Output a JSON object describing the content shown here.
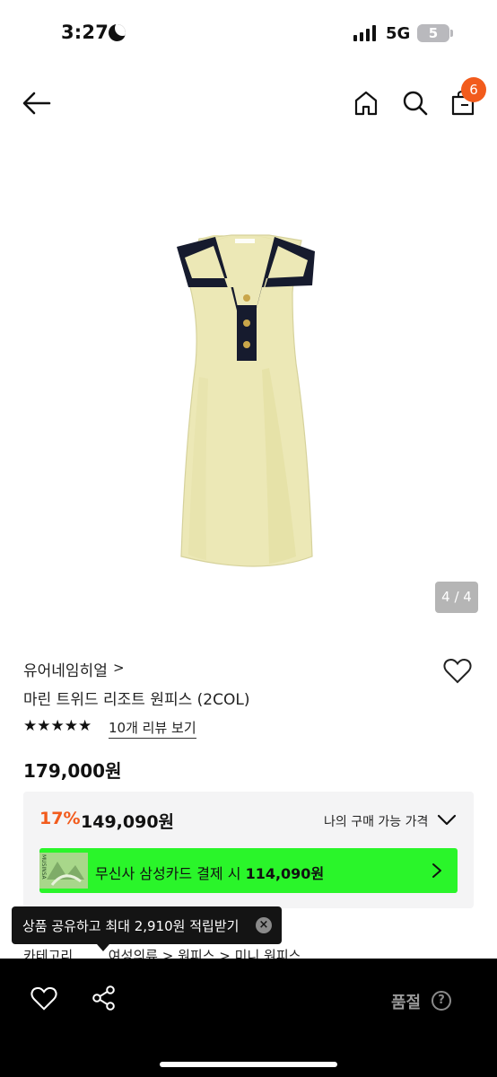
{
  "status": {
    "time": "3:27",
    "network": "5G",
    "battery": "5"
  },
  "header": {
    "cart_count": "6"
  },
  "gallery": {
    "counter": "4 / 4"
  },
  "product": {
    "brand": "유어네임히얼",
    "brand_chevron": ">",
    "title": "마린 트위드 리조트 원피스 (2COL)",
    "rating_stars": "★★★★★",
    "rating_value": 5,
    "review_link": "10개 리뷰 보기",
    "price": "179,000원"
  },
  "price_box": {
    "discount": "17%",
    "sale_price": "149,090원",
    "my_price_label": "나의 구매 가능 가격"
  },
  "card_banner": {
    "text_prefix": "무신사 삼성카드 결제 시",
    "amount": "114,090원",
    "thumb_label": "MUSINSA",
    "color": "#2af52a"
  },
  "tooltip": {
    "text": "상품 공유하고 최대 2,910원 적립받기",
    "close_symbol": "×"
  },
  "category": {
    "label": "카테고리",
    "path": [
      "여성의류",
      "원피스",
      "미니 원피스"
    ],
    "separator": ">"
  },
  "bottom_bar": {
    "soldout_label": "품절",
    "help_symbol": "?"
  },
  "colors": {
    "accent": "#f25b1c",
    "card_green": "#2af52a",
    "bar": "#000000"
  }
}
